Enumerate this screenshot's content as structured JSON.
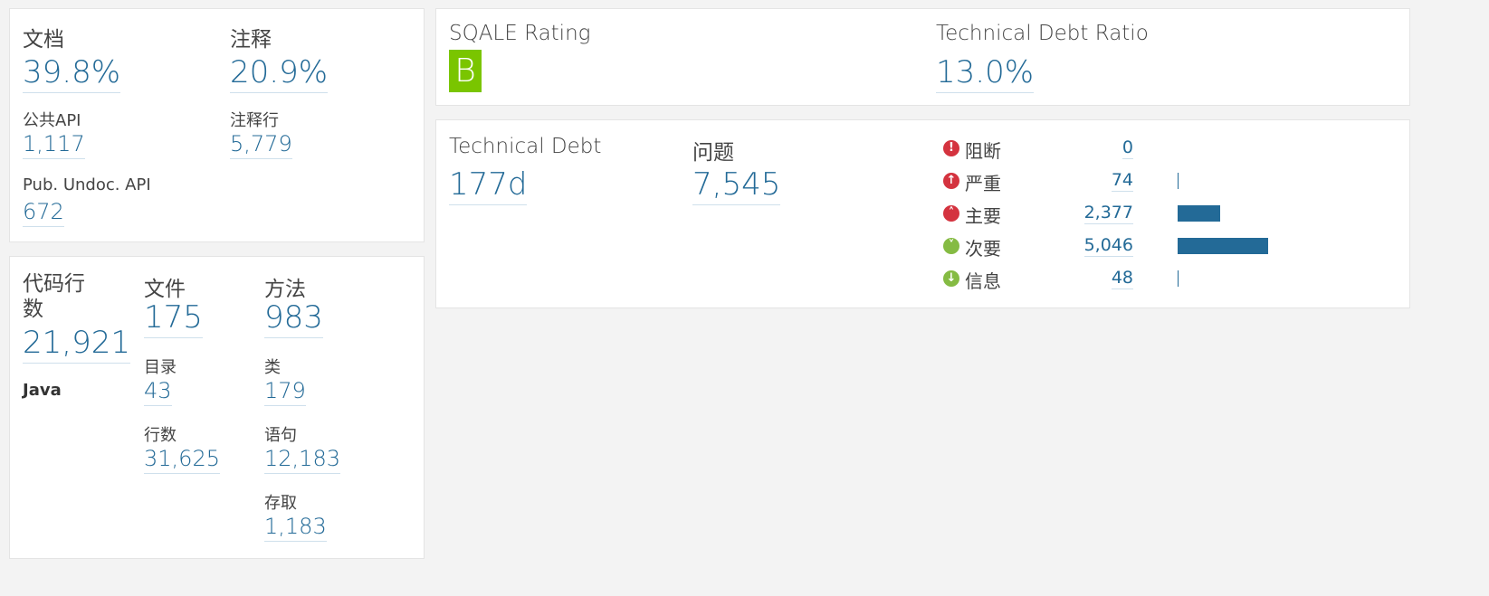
{
  "documentation": {
    "doc_label": "文档",
    "doc_value": "39.8%",
    "comments_label": "注释",
    "comments_value": "20.9%",
    "public_api_label": "公共API",
    "public_api_value": "1,117",
    "comment_lines_label": "注释行",
    "comment_lines_value": "5,779",
    "undoc_api_label": "Pub. Undoc. API",
    "undoc_api_value": "672"
  },
  "size": {
    "loc_label": "代码行数",
    "loc_value": "21,921",
    "language": "Java",
    "files_label": "文件",
    "files_value": "175",
    "dirs_label": "目录",
    "dirs_value": "43",
    "lines_label": "行数",
    "lines_value": "31,625",
    "methods_label": "方法",
    "methods_value": "983",
    "classes_label": "类",
    "classes_value": "179",
    "statements_label": "语句",
    "statements_value": "12,183",
    "accessors_label": "存取",
    "accessors_value": "1,183"
  },
  "sqale": {
    "rating_label": "SQALE Rating",
    "rating_value": "B",
    "rating_color": "#7ac500",
    "ratio_label": "Technical Debt Ratio",
    "ratio_value": "13.0%"
  },
  "debt": {
    "debt_label": "Technical Debt",
    "debt_value": "177d",
    "issues_label": "问题",
    "issues_value": "7,545"
  },
  "severities": [
    {
      "label": "阻断",
      "value": "0",
      "icon": "blocker-icon",
      "color": "#d4333f",
      "count": 0
    },
    {
      "label": "严重",
      "value": "74",
      "icon": "critical-icon",
      "color": "#d4333f",
      "count": 74
    },
    {
      "label": "主要",
      "value": "2,377",
      "icon": "major-icon",
      "color": "#d4333f",
      "count": 2377
    },
    {
      "label": "次要",
      "value": "5,046",
      "icon": "minor-icon",
      "color": "#85bb43",
      "count": 5046
    },
    {
      "label": "信息",
      "value": "48",
      "icon": "info-icon",
      "color": "#85bb43",
      "count": 48
    }
  ]
}
